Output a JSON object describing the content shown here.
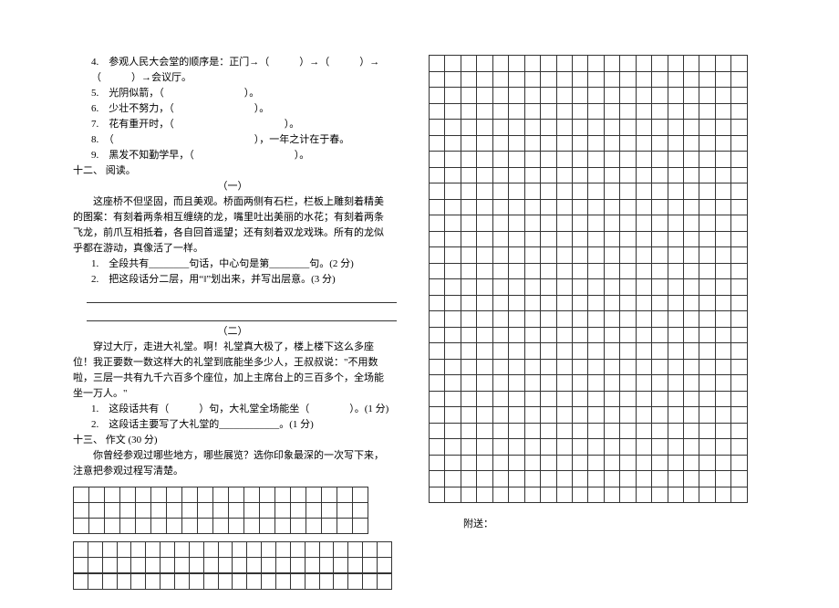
{
  "left": {
    "q4": "4.　参观人民大会堂的顺序是：正门→（　　　）→（　　　）→（　　　）→会议厅。",
    "q5": "5.　光阴似箭，（　　　　　　　　）。",
    "q6": "6.　少壮不努力，（　　　　　　　　）。",
    "q7": "7.　花有重开时，（　　　　　　　　　　　）。",
    "q8": "8.　（　　　　　　　　　　　　　　），一年之计在于春。",
    "q9": "9.　黑发不知勤学早，（　　　　　　　　　　）。",
    "s12": "十二、 阅读。",
    "p1_title": "（一）",
    "p1_body": "　　这座桥不但坚固，而且美观。桥面两侧有石栏，栏板上雕刻着精美的图案：有刻着两条相互缠绕的龙，嘴里吐出美丽的水花；有刻着两条飞龙，前爪互相抵着，各自回首遥望；还有刻着双龙戏珠。所有的龙似乎都在游动，真像活了一样。",
    "p1_q1": "1.　全段共有________句话，中心句是第________句。(2 分)",
    "p1_q2": "2.　把这段话分二层，用“‖”划出来，并写出层意。(3 分)",
    "p2_title": "（二）",
    "p2_body": "　　穿过大厅，走进大礼堂。啊！礼堂真大极了，楼上楼下这么多座位！我正要数一数这样大的礼堂到底能坐多少人，王叔叔说：\"不用数啦，三层一共有九千六百多个座位，加上主席台上的三百多个，全场能坐一万人。\"",
    "p2_q1": "1.　这段话共有（　　　）句，大礼堂全场能坐（　　　　）。(1 分)",
    "p2_q2": "2.　这段话主要写了大礼堂的____________。(1 分)",
    "s13": "十三、 作文 (30 分)",
    "s13_body": "　　你曾经参观过哪些地方，哪些展览？选你印象最深的一次写下来，注意把参观过程写清楚。"
  },
  "right": {
    "appendix": "附送："
  }
}
